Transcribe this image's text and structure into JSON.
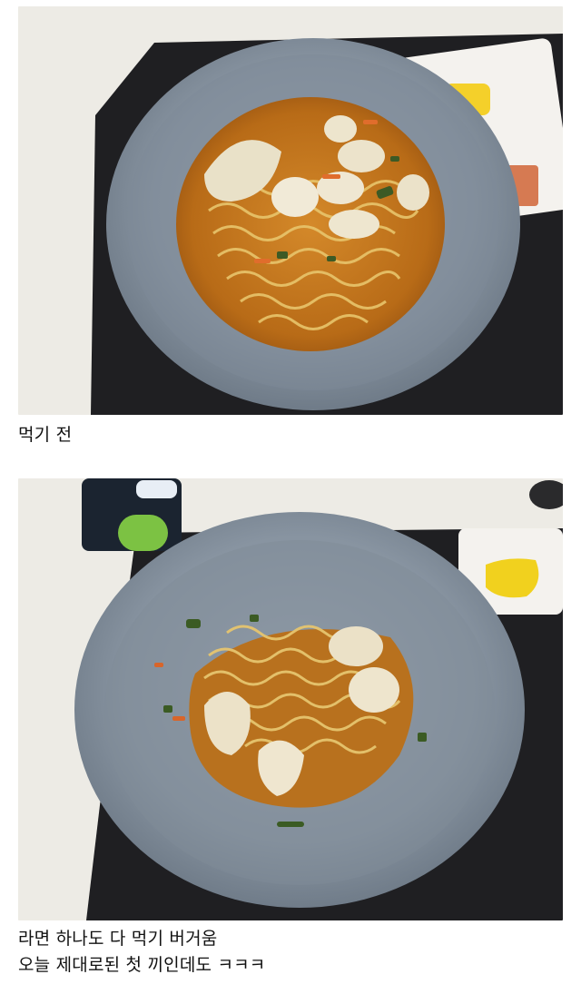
{
  "captions": {
    "before": "먹기 전",
    "after_line1": "라면 하나도 다 먹기 버거움",
    "after_line2": "오늘 제대로된 첫 끼인데도 ㅋㅋㅋ"
  },
  "colors": {
    "table": "#eeece6",
    "tray": "#1d1d1f",
    "bowl": "#8e9aa6",
    "broth": "#c2781e",
    "noodle": "#e6c26a"
  }
}
